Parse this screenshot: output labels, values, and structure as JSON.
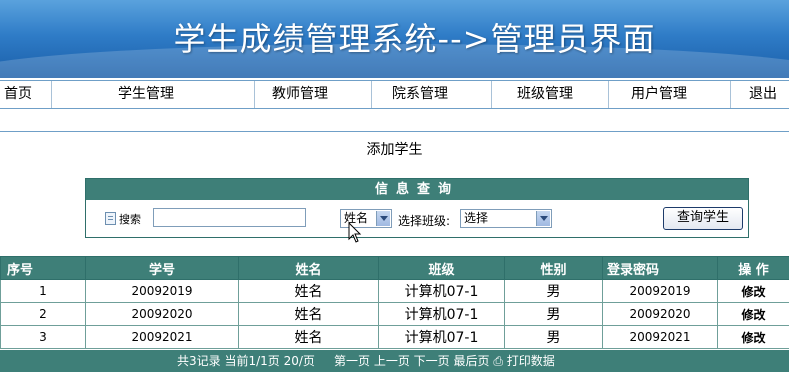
{
  "header": {
    "title": "学生成绩管理系统-->管理员界面"
  },
  "nav": {
    "items": [
      {
        "label": "首页"
      },
      {
        "label": "学生管理"
      },
      {
        "label": "教师管理"
      },
      {
        "label": "院系管理"
      },
      {
        "label": "班级管理"
      },
      {
        "label": "用户管理"
      },
      {
        "label": "退出"
      }
    ]
  },
  "main": {
    "add_student": "添加学生"
  },
  "search": {
    "title": "信息查询",
    "label": "搜索",
    "input_value": "",
    "field_select": "姓名",
    "class_label": "选择班级:",
    "class_select": "选择",
    "button": "查询学生"
  },
  "table": {
    "headers": [
      "序号",
      "学号",
      "姓名",
      "班级",
      "性别",
      "登录密码",
      "操 作"
    ],
    "rows": [
      {
        "no": "1",
        "id": "20092019",
        "name": "姓名",
        "class": "计算机07-1",
        "gender": "男",
        "password": "20092019",
        "op": "修改"
      },
      {
        "no": "2",
        "id": "20092020",
        "name": "姓名",
        "class": "计算机07-1",
        "gender": "男",
        "password": "20092020",
        "op": "修改"
      },
      {
        "no": "3",
        "id": "20092021",
        "name": "姓名",
        "class": "计算机07-1",
        "gender": "男",
        "password": "20092021",
        "op": "修改"
      }
    ]
  },
  "footer": {
    "summary": "共3记录  当前1/1页   20/页",
    "first": "第一页",
    "prev": "上一页",
    "next": "下一页",
    "last": "最后页",
    "print": "打印数据"
  },
  "colors": {
    "header_blue": "#2f7cc7",
    "teal": "#3e7f78"
  }
}
